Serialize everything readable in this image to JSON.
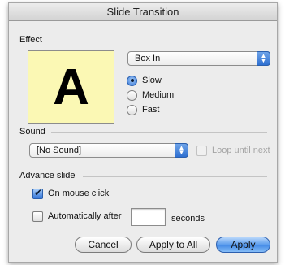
{
  "window": {
    "title": "Slide Transition"
  },
  "effect": {
    "section_label": "Effect",
    "preview_letter": "A",
    "selected": "Box In",
    "speed_options": [
      {
        "label": "Slow",
        "selected": true
      },
      {
        "label": "Medium",
        "selected": false
      },
      {
        "label": "Fast",
        "selected": false
      }
    ]
  },
  "sound": {
    "section_label": "Sound",
    "selected": "[No Sound]",
    "loop_label": "Loop until next",
    "loop_checked": false,
    "loop_enabled": false
  },
  "advance": {
    "section_label": "Advance slide",
    "on_mouse_click_label": "On mouse click",
    "on_mouse_click_checked": true,
    "auto_label": "Automatically after",
    "auto_checked": false,
    "seconds_value": "",
    "seconds_label": "seconds"
  },
  "buttons": {
    "cancel": "Cancel",
    "apply_all": "Apply to All",
    "apply": "Apply"
  },
  "colors": {
    "preview_bg": "#fbf8b4",
    "accent": "#3f87e6"
  }
}
